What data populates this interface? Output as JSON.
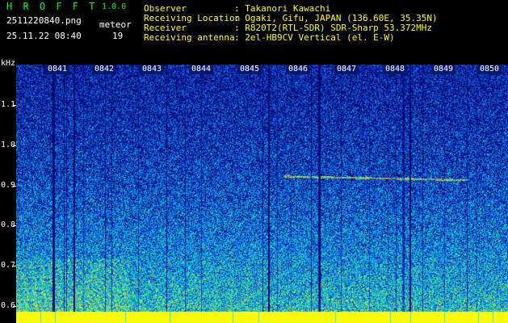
{
  "app": {
    "name": "H R O F F T",
    "version": "1.0.0"
  },
  "file": {
    "name": "2511220840.png",
    "datetime": "25.11.22 08:40"
  },
  "meteor": {
    "label": "meteor",
    "count": "19"
  },
  "info": [
    {
      "key": "Observer",
      "value": ": Takanori Kawachi"
    },
    {
      "key": "Receiving Location",
      "value": ": Ogaki, Gifu, JAPAN (136.60E, 35.35N)"
    },
    {
      "key": "Receiver",
      "value": ": R820T2(RTL-SDR) SDR-Sharp 53.372MHz"
    },
    {
      "key": "Receiving antenna",
      "value": ": 2el-HB9CV Vertical (el. E-W)"
    }
  ],
  "axis": {
    "y_unit": "kHz",
    "y_ticks": [
      "1.1",
      "1.0",
      "0.9",
      "0.8",
      "0.7",
      "0.6"
    ],
    "x_ticks": [
      "0841",
      "0842",
      "0843",
      "0844",
      "0845",
      "0846",
      "0847",
      "0848",
      "0849",
      "0850"
    ]
  },
  "colors": {
    "title": "#00ff00",
    "info": "#ffff00",
    "label": "#ffffff",
    "background": "#000000"
  }
}
